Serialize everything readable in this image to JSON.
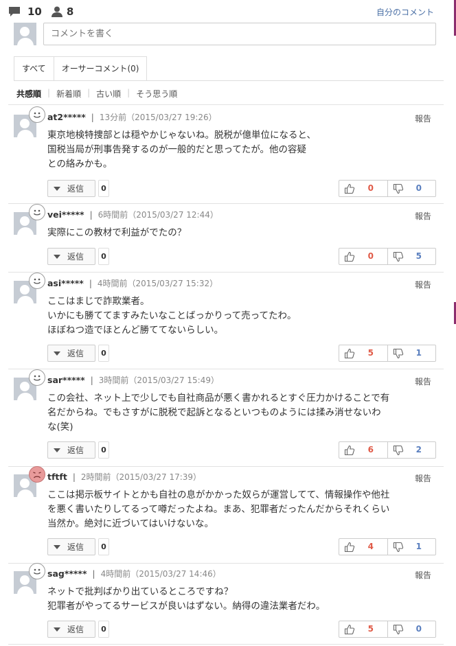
{
  "header": {
    "comment_count": "10",
    "user_count": "8",
    "my_comments_link": "自分のコメント"
  },
  "compose": {
    "placeholder": "コメントを書く"
  },
  "tabs": [
    {
      "label": "すべて",
      "active": true
    },
    {
      "label": "オーサーコメント(0)",
      "active": false
    }
  ],
  "sort": [
    {
      "label": "共感順",
      "active": true
    },
    {
      "label": "新着順",
      "active": false
    },
    {
      "label": "古い順",
      "active": false
    },
    {
      "label": "そう思う順",
      "active": false
    }
  ],
  "labels": {
    "report": "報告",
    "reply": "返信"
  },
  "comments": [
    {
      "user": "at2*****",
      "time": "13分前（2015/03/27 19:26）",
      "mood": "happy",
      "lines": [
        "東京地検特捜部とは穏やかじゃないね。脱税が億単位になると、",
        "国税当局が刑事告発するのが一般的だと思ってたが。他の容疑",
        "との絡みかも。"
      ],
      "replies": "0",
      "good": "0",
      "bad": "0"
    },
    {
      "user": "vei*****",
      "time": "6時間前（2015/03/27 12:44）",
      "mood": "happy",
      "lines": [
        "実際にこの教材で利益がでたの？"
      ],
      "replies": "0",
      "good": "0",
      "bad": "5"
    },
    {
      "user": "asi*****",
      "time": "4時間前（2015/03/27 15:32）",
      "mood": "happy",
      "lines": [
        "ここはまじで詐欺業者。",
        "いかにも勝ててますみたいなことばっかりって売ってたわ。",
        "ほぼねつ造でほとんど勝ててないらしい。"
      ],
      "replies": "0",
      "good": "5",
      "bad": "1"
    },
    {
      "user": "sar*****",
      "time": "3時間前（2015/03/27 15:49）",
      "mood": "happy",
      "lines": [
        "この会社、ネット上で少しでも自社商品が悪く書かれるとすぐ圧力かけることで有",
        "名だからね。でもさすがに脱税で起訴となるといつものようには揉み消せないわ",
        "な(笑)"
      ],
      "replies": "0",
      "good": "6",
      "bad": "2"
    },
    {
      "user": "tftft",
      "time": "2時間前（2015/03/27 17:39）",
      "mood": "sad",
      "lines": [
        "ここは掲示板サイトとかも自社の息がかかった奴らが運営してて、情報操作や他社",
        "を悪く書いたりしてるって噂だったよね。まあ、犯罪者だったんだからそれくらい",
        "当然か。絶対に近づいてはいけないな。"
      ],
      "replies": "0",
      "good": "4",
      "bad": "1"
    },
    {
      "user": "sag*****",
      "time": "4時間前（2015/03/27 14:46）",
      "mood": "happy",
      "lines": [
        "ネットで批判ばかり出ているところですね？",
        "犯罪者がやってるサービスが良いはずない。納得の違法業者だわ。"
      ],
      "replies": "0",
      "good": "5",
      "bad": "0"
    }
  ]
}
